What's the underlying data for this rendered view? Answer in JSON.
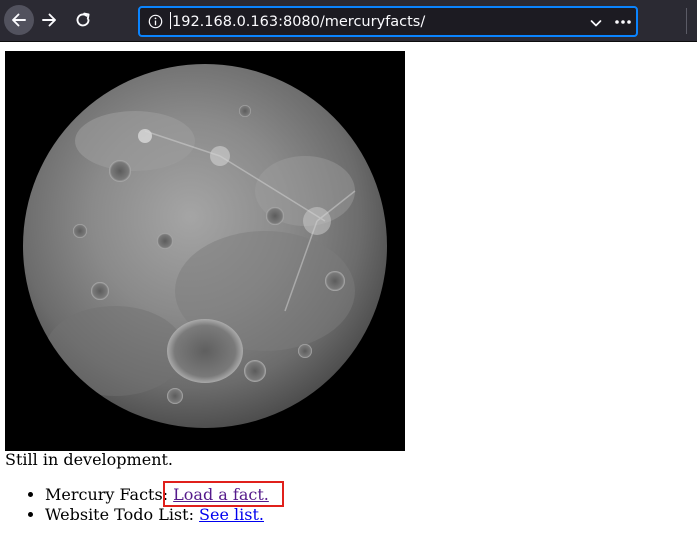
{
  "browser": {
    "url": "192.168.0.163:8080/mercuryfacts/",
    "icons": {
      "back": "arrow-left-icon",
      "forward": "arrow-right-icon",
      "reload": "reload-icon",
      "site_info": "info-icon",
      "url_dropdown": "chevron-down-icon",
      "page_actions": "more-dots-icon"
    },
    "colors": {
      "toolbar_bg": "#2b2a33",
      "urlbar_bg": "#1c1b22",
      "urlbar_focus": "#0a84ff"
    }
  },
  "page": {
    "image_subject": "planet-mercury",
    "status_text": "Still in development.",
    "links": [
      {
        "label": "Mercury Facts: ",
        "link_text": "Load a fact."
      },
      {
        "label": "Website Todo List: ",
        "link_text": "See list."
      }
    ],
    "colors": {
      "visited_link": "#551a8b",
      "unvisited_link": "#0000ee",
      "highlight": "#e0201b"
    }
  }
}
